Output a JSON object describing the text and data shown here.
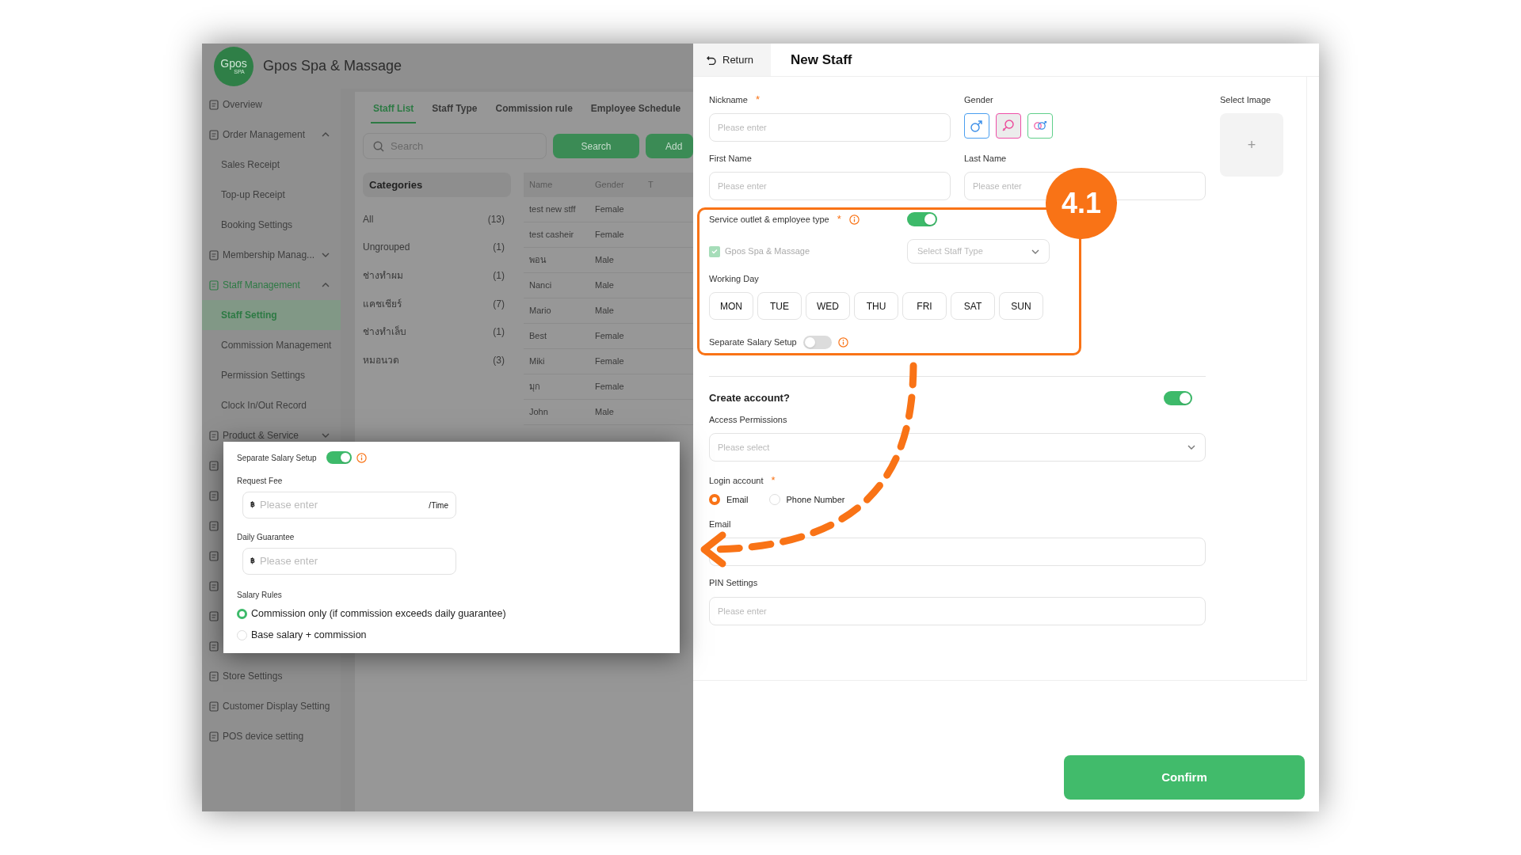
{
  "app": {
    "logo_text": "Gpos",
    "logo_subtext": "SPA",
    "title": "Gpos Spa & Massage"
  },
  "sidebar": {
    "items": [
      {
        "label": "Overview",
        "selected": false
      },
      {
        "label": "Order Management",
        "expanded": true,
        "selected": false,
        "children": [
          {
            "label": "Sales Receipt",
            "selected": false
          },
          {
            "label": "Top-up Receipt",
            "selected": false
          },
          {
            "label": "Booking Settings",
            "selected": false
          }
        ]
      },
      {
        "label": "Membership Manag...",
        "expanded": false,
        "selected": false
      },
      {
        "label": "Staff Management",
        "expanded": true,
        "selected": true,
        "children": [
          {
            "label": "Staff Setting",
            "selected": true
          },
          {
            "label": "Commission Management",
            "selected": false
          },
          {
            "label": "Permission Settings",
            "selected": false
          },
          {
            "label": "Clock In/Out Record",
            "selected": false
          }
        ]
      },
      {
        "label": "Product & Service",
        "expanded": false,
        "selected": false
      }
    ],
    "bottom_items": [
      {
        "label": "Store Settings",
        "selected": false
      },
      {
        "label": "Customer Display Setting",
        "selected": false
      },
      {
        "label": "POS device setting",
        "selected": false
      }
    ]
  },
  "staff_page": {
    "tabs": [
      {
        "label": "Staff List",
        "selected": true
      },
      {
        "label": "Staff Type",
        "selected": false
      },
      {
        "label": "Commission rule",
        "selected": false
      },
      {
        "label": "Employee Schedule",
        "selected": false
      }
    ],
    "search": {
      "placeholder": "Search"
    },
    "buttons": [
      "Search",
      "Add"
    ],
    "categories": {
      "title": "Categories",
      "items": [
        {
          "label": "All",
          "count": "(13)"
        },
        {
          "label": "Ungrouped",
          "count": "(1)"
        },
        {
          "label": "ช่างทำผม",
          "count": "(1)"
        },
        {
          "label": "แคชเชียร์",
          "count": "(7)"
        },
        {
          "label": "ช่างทำเล็บ",
          "count": "(1)"
        },
        {
          "label": "หมอนวด",
          "count": "(3)"
        }
      ]
    },
    "table": {
      "columns": [
        "Name",
        "Gender",
        "T"
      ],
      "rows": [
        [
          "test new stff",
          "Female"
        ],
        [
          "test casheir",
          "Female"
        ],
        [
          "พอน",
          "Male"
        ],
        [
          "Nanci",
          "Male"
        ],
        [
          "Mario",
          "Male"
        ],
        [
          "Best",
          "Female"
        ],
        [
          "Miki",
          "Female"
        ],
        [
          "มุก",
          "Female"
        ],
        [
          "John",
          "Male"
        ]
      ]
    }
  },
  "salary_popup": {
    "toggle_label": "Separate Salary Setup",
    "on": true,
    "fields": [
      {
        "label": "Request Fee",
        "prefix": "฿",
        "placeholder": "Please enter",
        "suffix": "/Time"
      },
      {
        "label": "Daily Guarantee",
        "prefix": "฿",
        "placeholder": "Please enter"
      }
    ],
    "rules_label": "Salary Rules",
    "rules": [
      {
        "label": "Commission only (if commission exceeds daily guarantee)",
        "selected": true
      },
      {
        "label": "Base salary + commission",
        "selected": false
      }
    ]
  },
  "new_staff": {
    "return": "Return",
    "title": "New Staff",
    "nickname": {
      "label": "Nickname",
      "required": "*",
      "placeholder": "Please enter"
    },
    "gender": {
      "label": "Gender",
      "options": [
        {
          "kind": "male",
          "selected": false
        },
        {
          "kind": "female",
          "selected": true
        },
        {
          "kind": "other",
          "selected": false
        }
      ]
    },
    "select_image": {
      "label": "Select Image",
      "button": "+"
    },
    "first_name": {
      "label": "First Name",
      "placeholder": "Please enter"
    },
    "last_name": {
      "label": "Last Name",
      "placeholder": "Please enter"
    },
    "outlet": {
      "label": "Service outlet & employee type",
      "required": "*",
      "on": true,
      "outlet_name": "Gpos Spa & Massage",
      "checked": true,
      "staff_type_placeholder": "Select Staff Type"
    },
    "working_day": {
      "label": "Working Day",
      "days": [
        {
          "label": "MON",
          "selected": false
        },
        {
          "label": "TUE",
          "selected": false
        },
        {
          "label": "WED",
          "selected": false
        },
        {
          "label": "THU",
          "selected": false
        },
        {
          "label": "FRI",
          "selected": false
        },
        {
          "label": "SAT",
          "selected": false
        },
        {
          "label": "SUN",
          "selected": false
        }
      ]
    },
    "separate_salary": {
      "label": "Separate Salary Setup",
      "on": false
    },
    "create_account": {
      "label": "Create account?",
      "on": true
    },
    "access_permissions": {
      "label": "Access Permissions",
      "placeholder": "Please select"
    },
    "login_account": {
      "label": "Login account",
      "required": "*",
      "options": [
        {
          "label": "Email",
          "selected": true
        },
        {
          "label": "Phone Number",
          "selected": false
        }
      ]
    },
    "email": {
      "label": "Email"
    },
    "pin": {
      "label": "PIN Settings",
      "placeholder": "Please enter"
    },
    "confirm": "Confirm"
  },
  "annotation": {
    "badge": "4.1"
  }
}
